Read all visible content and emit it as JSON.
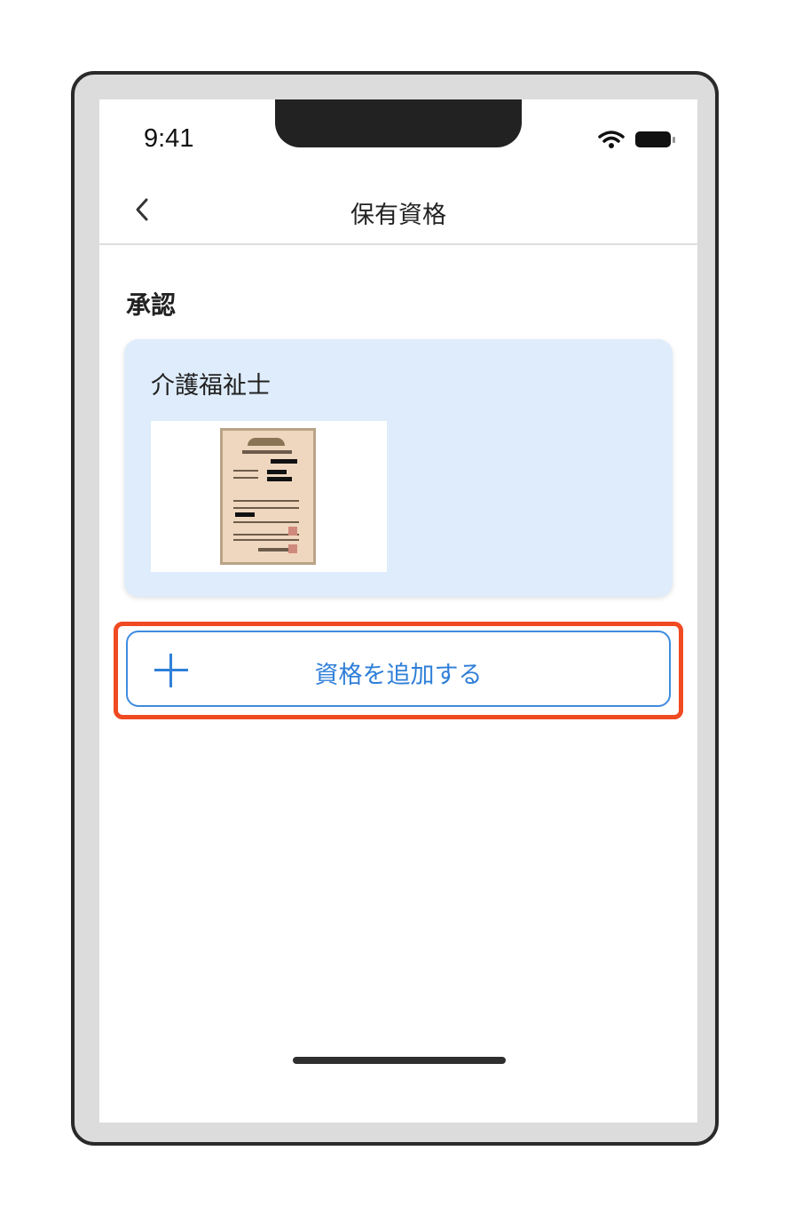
{
  "status_bar": {
    "time": "9:41"
  },
  "navigation": {
    "title": "保有資格"
  },
  "section": {
    "title": "承認"
  },
  "certificate_card": {
    "title": "介護福祉士",
    "thumbnail_icon": "certificate-image"
  },
  "actions": {
    "add_label": "資格を追加する"
  },
  "colors": {
    "accent": "#2f7fd8",
    "highlight": "#f04a22",
    "card_background": "#deecfb"
  }
}
